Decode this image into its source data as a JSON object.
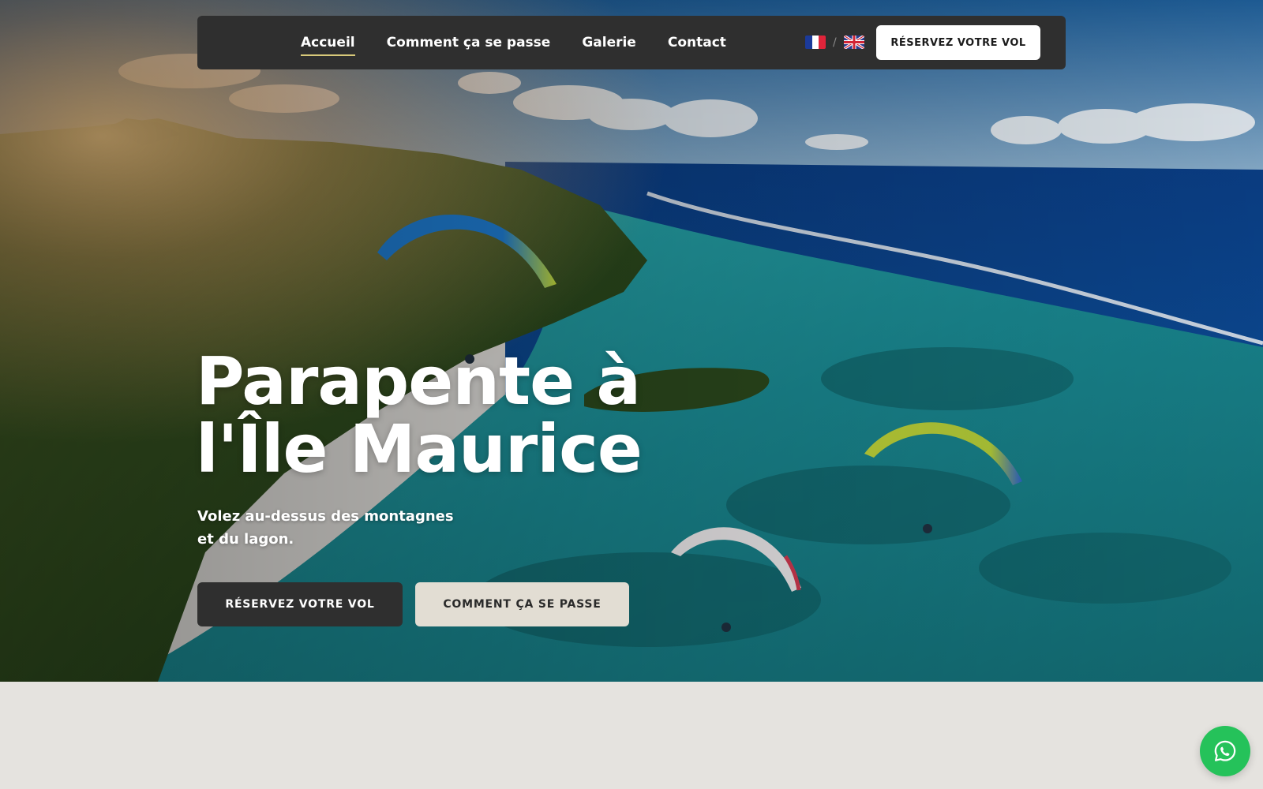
{
  "nav": {
    "links": [
      {
        "label": "Accueil",
        "active": true
      },
      {
        "label": "Comment ça se passe",
        "active": false
      },
      {
        "label": "Galerie",
        "active": false
      },
      {
        "label": "Contact",
        "active": false
      }
    ],
    "lang_separator": "/",
    "languages": [
      {
        "code": "fr",
        "icon": "france-flag-icon"
      },
      {
        "code": "en",
        "icon": "uk-flag-icon"
      }
    ],
    "cta_label": "RÉSERVEZ VOTRE VOL"
  },
  "hero": {
    "title_line1": "Parapente à",
    "title_line2": "l'Île Maurice",
    "subtitle_line1": "Volez au-dessus des montagnes",
    "subtitle_line2": "et du lagon.",
    "primary_button": "RÉSERVEZ VOTRE VOL",
    "secondary_button": "COMMENT ÇA SE PASSE"
  },
  "floating": {
    "icon": "whatsapp-icon",
    "color": "#25c25a"
  },
  "colors": {
    "nav_bg": "#2f2f2f",
    "active_underline": "#d8c97a",
    "secondary_button_bg": "#e2ddd3",
    "section_bg": "#e5e3df"
  }
}
